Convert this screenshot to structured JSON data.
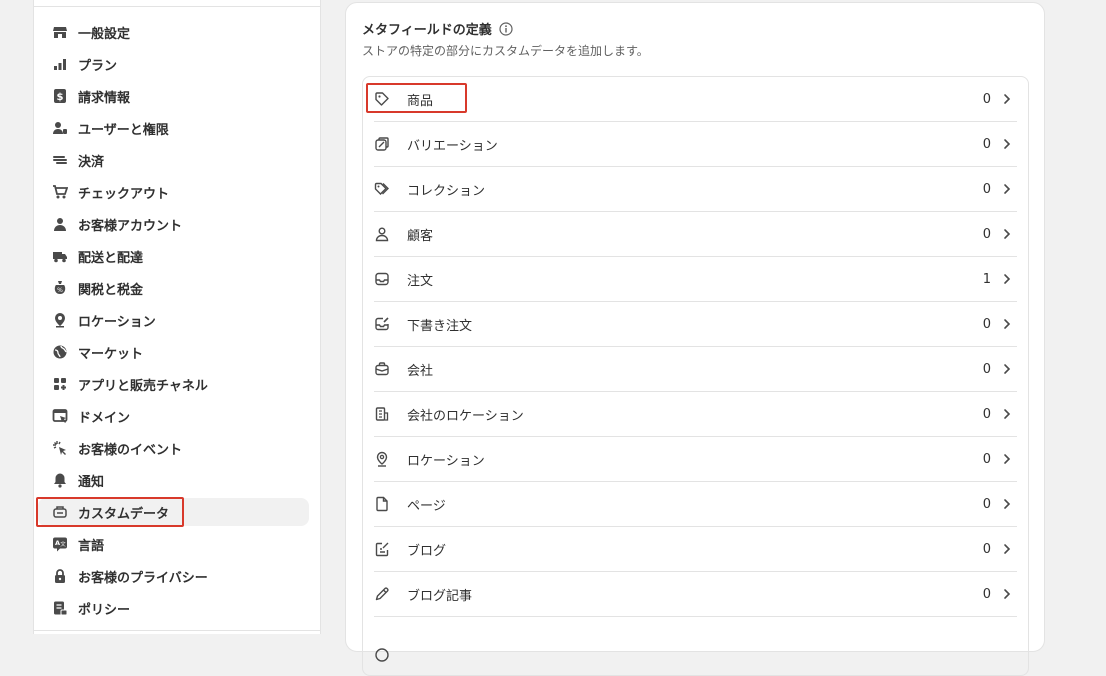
{
  "sidebar": {
    "items": [
      {
        "label": "一般設定",
        "icon": "store-icon"
      },
      {
        "label": "プラン",
        "icon": "plan-chart-icon"
      },
      {
        "label": "請求情報",
        "icon": "billing-dollar-icon"
      },
      {
        "label": "ユーザーと権限",
        "icon": "users-lock-icon"
      },
      {
        "label": "決済",
        "icon": "payments-icon"
      },
      {
        "label": "チェックアウト",
        "icon": "cart-icon"
      },
      {
        "label": "お客様アカウント",
        "icon": "person-icon"
      },
      {
        "label": "配送と配達",
        "icon": "truck-icon"
      },
      {
        "label": "関税と税金",
        "icon": "tax-bag-icon"
      },
      {
        "label": "ロケーション",
        "icon": "location-pin-icon"
      },
      {
        "label": "マーケット",
        "icon": "globe-icon"
      },
      {
        "label": "アプリと販売チャネル",
        "icon": "apps-grid-icon"
      },
      {
        "label": "ドメイン",
        "icon": "domain-icon"
      },
      {
        "label": "お客様のイベント",
        "icon": "cursor-click-icon"
      },
      {
        "label": "通知",
        "icon": "bell-icon"
      },
      {
        "label": "カスタムデータ",
        "icon": "custom-data-icon"
      },
      {
        "label": "言語",
        "icon": "language-icon"
      },
      {
        "label": "お客様のプライバシー",
        "icon": "lock-icon"
      },
      {
        "label": "ポリシー",
        "icon": "policy-icon"
      }
    ],
    "active_index": 15
  },
  "main": {
    "title": "メタフィールドの定義",
    "subtitle": "ストアの特定の部分にカスタムデータを追加します。",
    "rows": [
      {
        "label": "商品",
        "count": "0",
        "icon": "tag-icon"
      },
      {
        "label": "バリエーション",
        "count": "0",
        "icon": "variant-icon"
      },
      {
        "label": "コレクション",
        "count": "0",
        "icon": "collection-tags-icon"
      },
      {
        "label": "顧客",
        "count": "0",
        "icon": "customer-icon"
      },
      {
        "label": "注文",
        "count": "1",
        "icon": "order-inbox-icon"
      },
      {
        "label": "下書き注文",
        "count": "0",
        "icon": "draft-order-icon"
      },
      {
        "label": "会社",
        "count": "0",
        "icon": "company-icon"
      },
      {
        "label": "会社のロケーション",
        "count": "0",
        "icon": "company-location-icon"
      },
      {
        "label": "ロケーション",
        "count": "0",
        "icon": "location-pin-icon"
      },
      {
        "label": "ページ",
        "count": "0",
        "icon": "page-icon"
      },
      {
        "label": "ブログ",
        "count": "0",
        "icon": "blog-icon"
      },
      {
        "label": "ブログ記事",
        "count": "0",
        "icon": "pencil-icon"
      }
    ]
  },
  "colors": {
    "highlight": "#d8392b",
    "active_bg": "#f1f1f1"
  }
}
